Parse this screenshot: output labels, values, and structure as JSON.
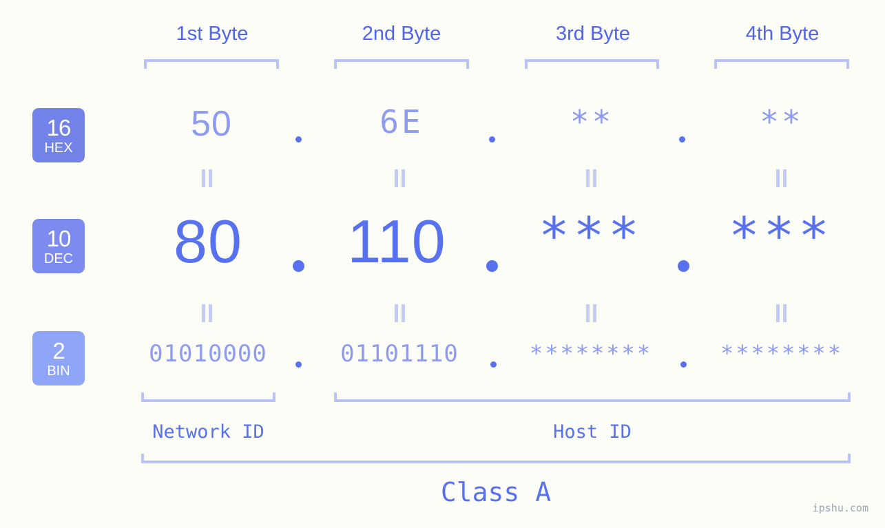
{
  "site": {
    "watermark": "ipshu.com"
  },
  "byte_headers": [
    {
      "label": "1st Byte"
    },
    {
      "label": "2nd Byte"
    },
    {
      "label": "3rd Byte"
    },
    {
      "label": "4th Byte"
    }
  ],
  "radix_badges": [
    {
      "number": "16",
      "name": "HEX",
      "color": "#7382e8"
    },
    {
      "number": "10",
      "name": "DEC",
      "color": "#7d8bf0"
    },
    {
      "number": "2",
      "name": "BIN",
      "color": "#8fa5f7"
    }
  ],
  "rows": {
    "hex": {
      "values": [
        "50",
        "6E",
        "**",
        "**"
      ]
    },
    "dec": {
      "values": [
        "80",
        "110",
        "***",
        "***"
      ]
    },
    "bin": {
      "values": [
        "01010000",
        "01101110",
        "********",
        "********"
      ]
    }
  },
  "separators": {
    "dot": "."
  },
  "segments": {
    "network_id": "Network ID",
    "host_id": "Host ID",
    "class": "Class A"
  },
  "colors": {
    "background": "#fdfdf8",
    "accent_strong": "#5872ef",
    "accent_light": "#8d9bf0",
    "bracket": "#b9c3f7",
    "equals": "#c3cbf8",
    "header_text": "#4f64e8"
  }
}
